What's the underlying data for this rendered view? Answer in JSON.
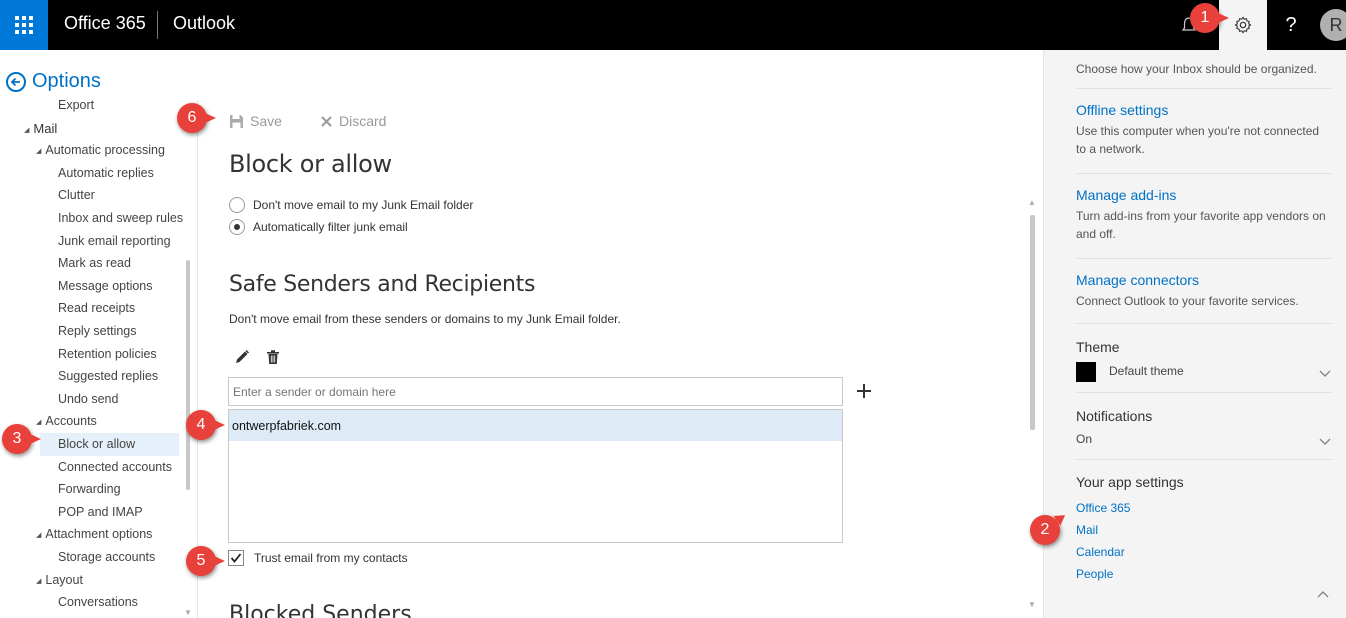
{
  "topbar": {
    "brand": "Office 365",
    "app": "Outlook",
    "help": "?",
    "avatar_initial": "R"
  },
  "nav": {
    "title": "Options",
    "items": [
      {
        "label": "Export",
        "level": 3
      },
      {
        "label": "Mail",
        "level": 1,
        "expanded": true
      },
      {
        "label": "Automatic processing",
        "level": 2,
        "expanded": true
      },
      {
        "label": "Automatic replies",
        "level": 3
      },
      {
        "label": "Clutter",
        "level": 3
      },
      {
        "label": "Inbox and sweep rules",
        "level": 3
      },
      {
        "label": "Junk email reporting",
        "level": 3
      },
      {
        "label": "Mark as read",
        "level": 3
      },
      {
        "label": "Message options",
        "level": 3
      },
      {
        "label": "Read receipts",
        "level": 3
      },
      {
        "label": "Reply settings",
        "level": 3
      },
      {
        "label": "Retention policies",
        "level": 3
      },
      {
        "label": "Suggested replies",
        "level": 3
      },
      {
        "label": "Undo send",
        "level": 3
      },
      {
        "label": "Accounts",
        "level": 2,
        "expanded": true
      },
      {
        "label": "Block or allow",
        "level": 3,
        "selected": true
      },
      {
        "label": "Connected accounts",
        "level": 3
      },
      {
        "label": "Forwarding",
        "level": 3
      },
      {
        "label": "POP and IMAP",
        "level": 3
      },
      {
        "label": "Attachment options",
        "level": 2,
        "expanded": true
      },
      {
        "label": "Storage accounts",
        "level": 3
      },
      {
        "label": "Layout",
        "level": 2,
        "expanded": true
      },
      {
        "label": "Conversations",
        "level": 3
      }
    ]
  },
  "toolbar": {
    "save_label": "Save",
    "discard_label": "Discard"
  },
  "main": {
    "title": "Block or allow",
    "radio_options": [
      {
        "label": "Don't move email to my Junk Email folder",
        "selected": false
      },
      {
        "label": "Automatically filter junk email",
        "selected": true
      }
    ],
    "safe_heading": "Safe Senders and Recipients",
    "safe_description": "Don't move email from these senders or domains to my Junk Email folder.",
    "sender_placeholder": "Enter a sender or domain here",
    "safe_list": [
      "ontwerpfabriek.com"
    ],
    "trust_contacts_label": "Trust email from my contacts",
    "trust_contacts_checked": true,
    "next_heading_partial": "Blocked Senders"
  },
  "settings_panel": {
    "layout_desc": "Choose how your Inbox should be organized.",
    "offline_link": "Offline settings",
    "offline_desc": "Use this computer when you're not connected to a network.",
    "addins_link": "Manage add-ins",
    "addins_desc": "Turn add-ins from your favorite app vendors on and off.",
    "connectors_link": "Manage connectors",
    "connectors_desc": "Connect Outlook to your favorite services.",
    "theme_label": "Theme",
    "theme_value": "Default theme",
    "theme_color": "#000000",
    "notifications_label": "Notifications",
    "notifications_value": "On",
    "app_settings_label": "Your app settings",
    "app_links": [
      "Office 365",
      "Mail",
      "Calendar",
      "People"
    ]
  },
  "markers": [
    "1",
    "2",
    "3",
    "4",
    "5",
    "6"
  ],
  "colors": {
    "accent": "#0072c6",
    "waffle": "#0078d7",
    "marker": "#e8403a",
    "selected_row": "#deebf7"
  }
}
